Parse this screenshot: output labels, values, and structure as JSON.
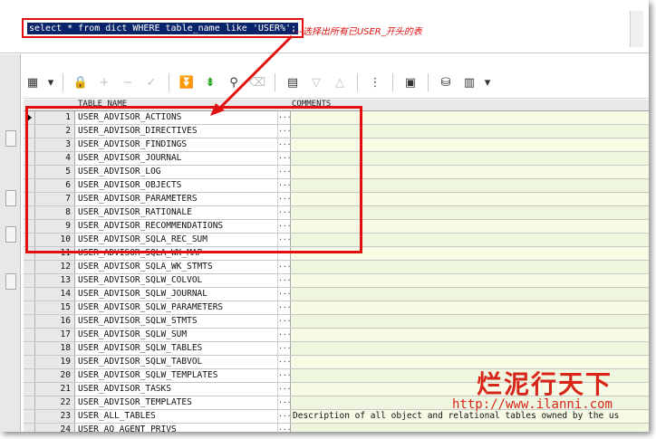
{
  "editor": {
    "sql": "select * from dict WHERE table_name like 'USER%';",
    "annotation": "---选择出所有已USER_开头的表"
  },
  "toolbar": {
    "icons": [
      "grid-layout-icon",
      "dropdown-arrow-icon",
      "lock-icon",
      "add-record-icon",
      "delete-record-icon",
      "post-changes-icon",
      "fetch-next-icon",
      "fetch-last-icon",
      "find-icon",
      "clear-icon",
      "query-by-example-icon",
      "filter-down-icon",
      "filter-up-icon",
      "tree-view-icon",
      "save-icon",
      "export-icon",
      "chart-icon",
      "chart-dropdown-icon"
    ]
  },
  "grid": {
    "columns": [
      "TABLE_NAME",
      "COMMENTS"
    ],
    "rows": [
      {
        "n": "1",
        "name": "USER_ADVISOR_ACTIONS",
        "comment": ""
      },
      {
        "n": "2",
        "name": "USER_ADVISOR_DIRECTIVES",
        "comment": ""
      },
      {
        "n": "3",
        "name": "USER_ADVISOR_FINDINGS",
        "comment": ""
      },
      {
        "n": "4",
        "name": "USER_ADVISOR_JOURNAL",
        "comment": ""
      },
      {
        "n": "5",
        "name": "USER_ADVISOR_LOG",
        "comment": ""
      },
      {
        "n": "6",
        "name": "USER_ADVISOR_OBJECTS",
        "comment": ""
      },
      {
        "n": "7",
        "name": "USER_ADVISOR_PARAMETERS",
        "comment": ""
      },
      {
        "n": "8",
        "name": "USER_ADVISOR_RATIONALE",
        "comment": ""
      },
      {
        "n": "9",
        "name": "USER_ADVISOR_RECOMMENDATIONS",
        "comment": ""
      },
      {
        "n": "10",
        "name": "USER_ADVISOR_SQLA_REC_SUM",
        "comment": ""
      },
      {
        "n": "11",
        "name": "USER_ADVISOR_SQLA_WK_MAP",
        "comment": ""
      },
      {
        "n": "12",
        "name": "USER_ADVISOR_SQLA_WK_STMTS",
        "comment": ""
      },
      {
        "n": "13",
        "name": "USER_ADVISOR_SQLW_COLVOL",
        "comment": ""
      },
      {
        "n": "14",
        "name": "USER_ADVISOR_SQLW_JOURNAL",
        "comment": ""
      },
      {
        "n": "15",
        "name": "USER_ADVISOR_SQLW_PARAMETERS",
        "comment": ""
      },
      {
        "n": "16",
        "name": "USER_ADVISOR_SQLW_STMTS",
        "comment": ""
      },
      {
        "n": "17",
        "name": "USER_ADVISOR_SQLW_SUM",
        "comment": ""
      },
      {
        "n": "18",
        "name": "USER_ADVISOR_SQLW_TABLES",
        "comment": ""
      },
      {
        "n": "19",
        "name": "USER_ADVISOR_SQLW_TABVOL",
        "comment": ""
      },
      {
        "n": "20",
        "name": "USER_ADVISOR_SQLW_TEMPLATES",
        "comment": ""
      },
      {
        "n": "21",
        "name": "USER_ADVISOR_TASKS",
        "comment": ""
      },
      {
        "n": "22",
        "name": "USER_ADVISOR_TEMPLATES",
        "comment": ""
      },
      {
        "n": "23",
        "name": "USER_ALL_TABLES",
        "comment": "Description of all object and relational tables owned by the us"
      },
      {
        "n": "24",
        "name": "USER_AQ_AGENT_PRIVS",
        "comment": ""
      }
    ]
  },
  "watermark": {
    "title": "烂泥行天下",
    "url": "http://www.ilanni.com"
  },
  "colors": {
    "highlight_red": "#e01010",
    "selection_blue": "#0a246a",
    "grid_green": "#f7fbe6"
  }
}
